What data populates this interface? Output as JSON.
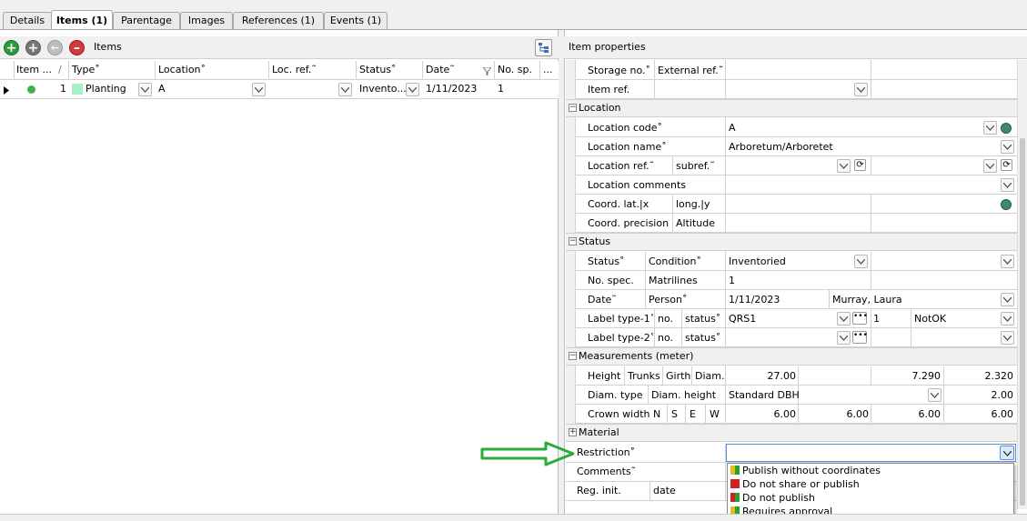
{
  "tabs": [
    {
      "label": "Details"
    },
    {
      "label": "Items (1)"
    },
    {
      "label": "Parentage"
    },
    {
      "label": "Images"
    },
    {
      "label": "References (1)"
    },
    {
      "label": "Events (1)"
    }
  ],
  "items_panel": {
    "title": "Items",
    "columns": [
      "Item ...",
      "/",
      "Type˚",
      "Location˚",
      "Loc. ref.˜",
      "Status˚",
      "Date˜",
      "No. sp.",
      "..."
    ],
    "rows": [
      {
        "item_no": "1",
        "type": "Planting",
        "location": "A",
        "loc_ref": "",
        "status": "Invento...",
        "date": "1/11/2023",
        "no_sp": "1"
      }
    ]
  },
  "properties": {
    "title": "Item properties",
    "top_rows": {
      "storage_no": "Storage no.˚",
      "external_ref": "External ref.˜",
      "item_ref": "Item ref."
    },
    "location": {
      "group": "Location",
      "code_label": "Location code˚",
      "code_value": "A",
      "name_label": "Location name˚",
      "name_value": "Arboretum/Arboretet",
      "ref_label": "Location ref.˜",
      "subref_label": "subref.˜",
      "comments_label": "Location comments",
      "lat_label": "Coord. lat.|x",
      "long_label": "long.|y",
      "precision_label": "Coord. precision",
      "altitude_label": "Altitude"
    },
    "status": {
      "group": "Status",
      "status_label": "Status˚",
      "condition_label": "Condition˚",
      "condition_value": "Inventoried",
      "no_spec_label": "No. spec.",
      "matrilines_label": "Matrilines",
      "matrilines_value": "1",
      "date_label": "Date˜",
      "person_label": "Person˚",
      "date_value": "1/11/2023",
      "person_value": "Murray, Laura",
      "label1_label": "Label type-1˚",
      "no_label": "no.",
      "status_small_label": "status˚",
      "label1_value": "QRS1",
      "label1_no": "1",
      "label1_status": "NotOK",
      "label2_label": "Label type-2˚"
    },
    "measurements": {
      "group": "Measurements (meter)",
      "height_label": "Height",
      "trunks_label": "Trunks",
      "girth_label": "Girth",
      "diam_label": "Diam.",
      "height_value": "27.00",
      "girth_value": "7.290",
      "diam_value": "2.320",
      "diam_type_label": "Diam. type",
      "diam_height_label": "Diam. height",
      "diam_type_value": "Standard DBH",
      "diam_height_value": "2.00",
      "crown_label": "Crown width N",
      "s_label": "S",
      "e_label": "E",
      "w_label": "W",
      "crown_n": "6.00",
      "crown_s": "6.00",
      "crown_e": "6.00",
      "crown_w": "6.00"
    },
    "material": {
      "group": "Material"
    },
    "restriction_label": "Restriction˚",
    "comments_label": "Comments˜",
    "reg_init_label": "Reg. init.",
    "date_label": "date"
  },
  "restriction_dropdown": {
    "options": [
      {
        "label": "Publish without coordinates",
        "colors": [
          "#e0c020",
          "#2aa02a"
        ]
      },
      {
        "label": "Do not share or publish",
        "colors": [
          "#d02020",
          "#d02020"
        ]
      },
      {
        "label": "Do not publish",
        "colors": [
          "#d02020",
          "#2aa02a"
        ]
      },
      {
        "label": "Requires approval",
        "colors": [
          "#e0c020",
          "#2aa02a"
        ]
      }
    ]
  },
  "colors": {
    "accent_arrow": "#2eaa3a",
    "add_button": "#2f9a3a",
    "remove_button": "#d23a3a",
    "planting_swatch": "#a6f0c8",
    "status_dot": "#3fb24a"
  }
}
